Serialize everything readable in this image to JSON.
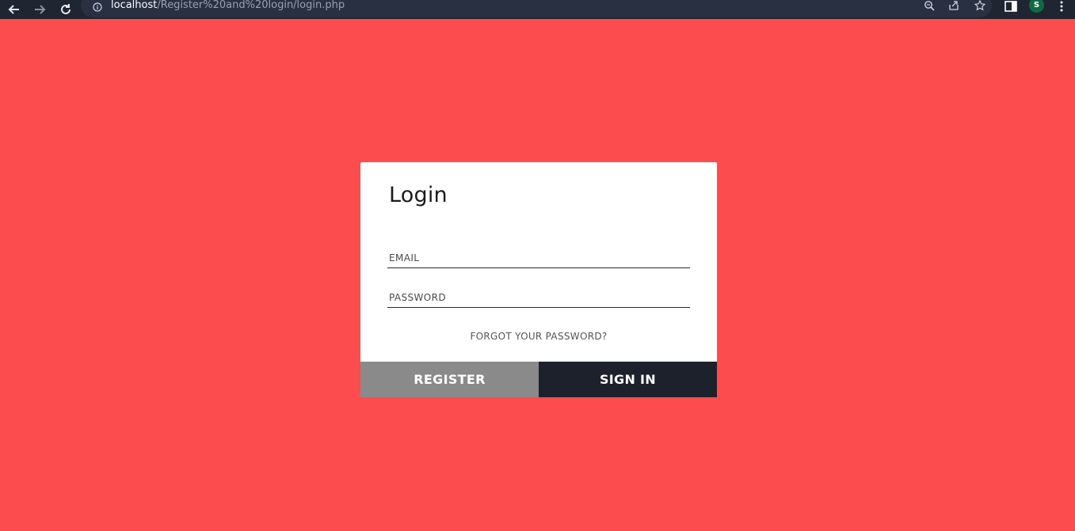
{
  "browser": {
    "url_host": "localhost",
    "url_path": "/Register%20and%20login/login.php",
    "profile_initial": "S"
  },
  "login": {
    "title": "Login",
    "email_placeholder": "EMAIL",
    "password_placeholder": "PASSWORD",
    "forgot_label": "FORGOT YOUR PASSWORD?",
    "register_label": "REGISTER",
    "signin_label": "SIGN IN"
  },
  "colors": {
    "background": "#fc4c4d",
    "register_button": "#8a8a8a",
    "signin_button": "#1d212c",
    "browser_bar": "#1f2531"
  }
}
